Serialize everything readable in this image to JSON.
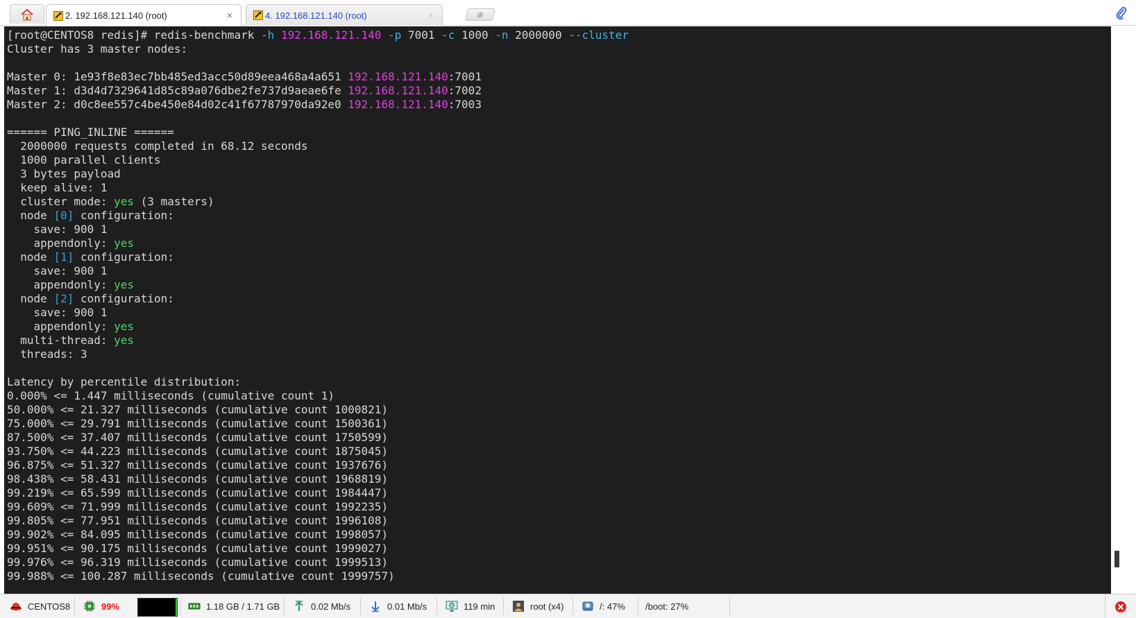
{
  "tabs": [
    {
      "label": "2. 192.168.121.140 (root)",
      "active": true,
      "close": "×"
    },
    {
      "label": "4. 192.168.121.140 (root)",
      "active": false,
      "close": "×"
    }
  ],
  "new_tab_symbol": "⊕",
  "terminal": {
    "lines": [
      [
        [
          "[root@CENTOS8 redis]# redis-benchmark ",
          ""
        ],
        [
          "-h ",
          "cyan"
        ],
        [
          "192.168.121.140 ",
          "magenta"
        ],
        [
          "-p ",
          "cyan"
        ],
        [
          "7001 ",
          ""
        ],
        [
          "-c ",
          "cyan"
        ],
        [
          "1000 ",
          ""
        ],
        [
          "-n ",
          "cyan"
        ],
        [
          "2000000 ",
          ""
        ],
        [
          "--cluster",
          "cyan"
        ]
      ],
      [
        [
          "Cluster has 3 master nodes:",
          ""
        ]
      ],
      [],
      [
        [
          "Master 0: 1e93f8e83ec7bb485ed3acc50d89eea468a4a651 ",
          ""
        ],
        [
          "192.168.121.140",
          "magenta"
        ],
        [
          ":7001",
          ""
        ]
      ],
      [
        [
          "Master 1: d3d4d7329641d85c89a076dbe2fe737d9aeae6fe ",
          ""
        ],
        [
          "192.168.121.140",
          "magenta"
        ],
        [
          ":7002",
          ""
        ]
      ],
      [
        [
          "Master 2: d0c8ee557c4be450e84d02c41f67787970da92e0 ",
          ""
        ],
        [
          "192.168.121.140",
          "magenta"
        ],
        [
          ":7003",
          ""
        ]
      ],
      [],
      [
        [
          "====== PING_INLINE ======",
          ""
        ]
      ],
      [
        [
          "  2000000 requests completed in 68.12 seconds",
          ""
        ]
      ],
      [
        [
          "  1000 parallel clients",
          ""
        ]
      ],
      [
        [
          "  3 bytes payload",
          ""
        ]
      ],
      [
        [
          "  keep alive: 1",
          ""
        ]
      ],
      [
        [
          "  cluster mode: ",
          ""
        ],
        [
          "yes",
          "green"
        ],
        [
          " (3 masters)",
          ""
        ]
      ],
      [
        [
          "  node ",
          ""
        ],
        [
          "[0]",
          "blue"
        ],
        [
          " configuration:",
          ""
        ]
      ],
      [
        [
          "    save: 900 1",
          ""
        ]
      ],
      [
        [
          "    appendonly: ",
          ""
        ],
        [
          "yes",
          "green"
        ]
      ],
      [
        [
          "  node ",
          ""
        ],
        [
          "[1]",
          "blue"
        ],
        [
          " configuration:",
          ""
        ]
      ],
      [
        [
          "    save: 900 1",
          ""
        ]
      ],
      [
        [
          "    appendonly: ",
          ""
        ],
        [
          "yes",
          "green"
        ]
      ],
      [
        [
          "  node ",
          ""
        ],
        [
          "[2]",
          "blue"
        ],
        [
          " configuration:",
          ""
        ]
      ],
      [
        [
          "    save: 900 1",
          ""
        ]
      ],
      [
        [
          "    appendonly: ",
          ""
        ],
        [
          "yes",
          "green"
        ]
      ],
      [
        [
          "  multi-thread: ",
          ""
        ],
        [
          "yes",
          "green"
        ]
      ],
      [
        [
          "  threads: 3",
          ""
        ]
      ],
      [],
      [
        [
          "Latency by percentile distribution:",
          ""
        ]
      ],
      [
        [
          "0.000% <= 1.447 milliseconds (cumulative count 1)",
          ""
        ]
      ],
      [
        [
          "50.000% <= 21.327 milliseconds (cumulative count 1000821)",
          ""
        ]
      ],
      [
        [
          "75.000% <= 29.791 milliseconds (cumulative count 1500361)",
          ""
        ]
      ],
      [
        [
          "87.500% <= 37.407 milliseconds (cumulative count 1750599)",
          ""
        ]
      ],
      [
        [
          "93.750% <= 44.223 milliseconds (cumulative count 1875045)",
          ""
        ]
      ],
      [
        [
          "96.875% <= 51.327 milliseconds (cumulative count 1937676)",
          ""
        ]
      ],
      [
        [
          "98.438% <= 58.431 milliseconds (cumulative count 1968819)",
          ""
        ]
      ],
      [
        [
          "99.219% <= 65.599 milliseconds (cumulative count 1984447)",
          ""
        ]
      ],
      [
        [
          "99.609% <= 71.999 milliseconds (cumulative count 1992235)",
          ""
        ]
      ],
      [
        [
          "99.805% <= 77.951 milliseconds (cumulative count 1996108)",
          ""
        ]
      ],
      [
        [
          "99.902% <= 84.095 milliseconds (cumulative count 1998057)",
          ""
        ]
      ],
      [
        [
          "99.951% <= 90.175 milliseconds (cumulative count 1999027)",
          ""
        ]
      ],
      [
        [
          "99.976% <= 96.319 milliseconds (cumulative count 1999513)",
          ""
        ]
      ],
      [
        [
          "99.988% <= 100.287 milliseconds (cumulative count 1999757)",
          ""
        ]
      ]
    ]
  },
  "status": {
    "host": "CENTOS8",
    "cpu": "99%",
    "memory": "1.18 GB / 1.71 GB",
    "upload": "0.02 Mb/s",
    "download": "0.01 Mb/s",
    "uptime": "119 min",
    "users": "root (x4)",
    "disk_root": "/: 47%",
    "disk_boot": "/boot: 27%"
  },
  "colors": {
    "terminal_bg": "#1e1e1e",
    "terminal_fg": "#d8d8d8",
    "magenta": "#e040e0",
    "cyan": "#3cb4e6",
    "green": "#4cd66c",
    "cpu_alert": "#e01010"
  }
}
